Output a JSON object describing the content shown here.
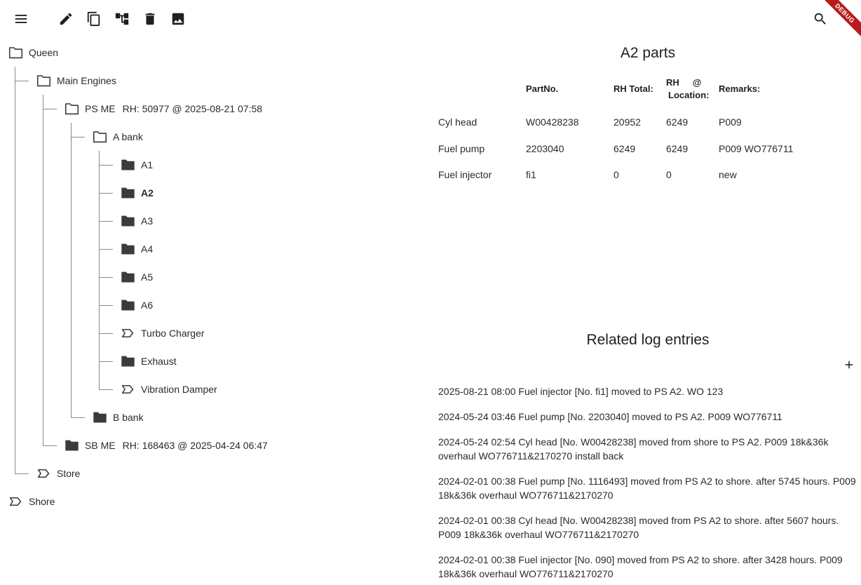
{
  "toolbar": {
    "icons": [
      "menu-icon",
      "edit-icon",
      "copy-icon",
      "hierarchy-icon",
      "delete-icon",
      "image-icon",
      "search-icon"
    ]
  },
  "debug_banner": "DEBUG",
  "tree": {
    "root": "Queen",
    "main_engines": "Main Engines",
    "ps_me": "PS ME",
    "ps_me_rh": "RH: 50977 @ 2025-08-21 07:58",
    "a_bank": "A bank",
    "a1": "A1",
    "a2": "A2",
    "a3": "A3",
    "a4": "A4",
    "a5": "A5",
    "a6": "A6",
    "turbo_charger": "Turbo Charger",
    "exhaust": "Exhaust",
    "vibration_damper": "Vibration Damper",
    "b_bank": "B bank",
    "sb_me": "SB ME",
    "sb_me_rh": "RH: 168463 @ 2025-04-24 06:47",
    "store": "Store",
    "shore": "Shore"
  },
  "parts": {
    "title": "A2 parts",
    "headers": {
      "partno": "PartNo.",
      "rh_total": "RH Total:",
      "rh_location_1": "RH",
      "rh_location_at": "@",
      "rh_location_2": "Location:",
      "remarks": "Remarks:"
    },
    "rows": [
      {
        "name": "Cyl head",
        "partno": "W00428238",
        "rh_total": "20952",
        "rh_location": "6249",
        "remarks": "P009"
      },
      {
        "name": "Fuel pump",
        "partno": "2203040",
        "rh_total": "6249",
        "rh_location": "6249",
        "remarks": "P009 WO776711"
      },
      {
        "name": "Fuel injector",
        "partno": "fi1",
        "rh_total": "0",
        "rh_location": "0",
        "remarks": "new"
      }
    ]
  },
  "log": {
    "title": "Related log entries",
    "entries": [
      "2025-08-21 08:00  Fuel injector [No. fi1] moved to  PS A2. WO 123",
      "2024-05-24 03:46  Fuel pump [No. 2203040] moved to  PS A2. P009 WO776711",
      "2024-05-24 02:54  Cyl head [No. W00428238] moved from shore to  PS A2. P009 18k&36k overhaul WO776711&2170270 install back",
      "2024-02-01 00:38  Fuel pump [No. 1116493] moved from PS A2 to  shore. after 5745 hours. P009 18k&36k overhaul WO776711&2170270",
      "2024-02-01 00:38  Cyl head [No. W00428238] moved from PS A2 to  shore. after 5607 hours. P009 18k&36k overhaul WO776711&2170270",
      "2024-02-01 00:38  Fuel injector [No. 090] moved from PS A2 to  shore. after 3428 hours. P009 18k&36k overhaul WO776711&2170270"
    ]
  }
}
